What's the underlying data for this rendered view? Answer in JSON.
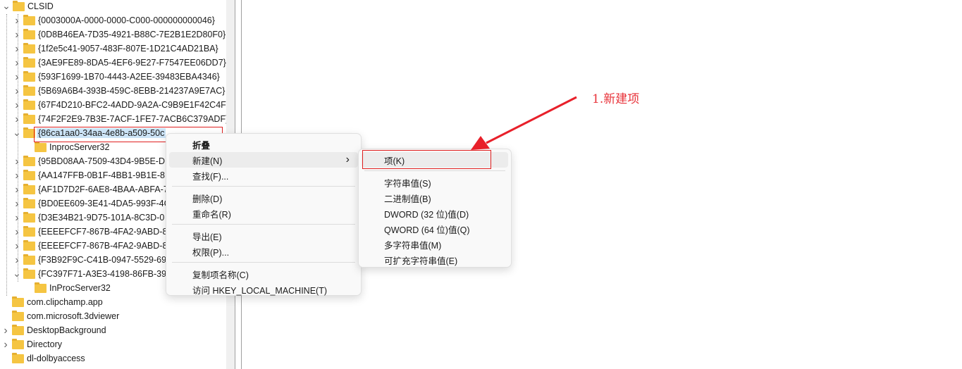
{
  "tree": {
    "root": {
      "label": "CLSID",
      "expanded": true
    },
    "children": [
      {
        "label": "{0003000A-0000-0000-C000-000000000046}"
      },
      {
        "label": "{0D8B46EA-7D35-4921-B88C-7E2B1E2D80F0}"
      },
      {
        "label": "{1f2e5c41-9057-483F-807E-1D21C4AD21BA}"
      },
      {
        "label": "{3AE9FE89-8DA5-4EF6-9E27-F7547EE06DD7}"
      },
      {
        "label": "{593F1699-1B70-4443-A2EE-39483EBA4346}"
      },
      {
        "label": "{5B69A6B4-393B-459C-8EBB-214237A9E7AC}"
      },
      {
        "label": "{67F4D210-BFC2-4ADD-9A2A-C9B9E1F42C4F}"
      },
      {
        "label": "{74F2F2E9-7B3E-7ACF-1FE7-7ACB6C379ADF}"
      },
      {
        "label": "{86ca1aa0-34aa-4e8b-a509-50c",
        "expanded": true,
        "selected": true
      },
      {
        "label": "InprocServer32",
        "child": true
      },
      {
        "label": "{95BD08AA-7509-43D4-9B5E-D"
      },
      {
        "label": "{AA147FFB-0B1F-4BB1-9B1E-8D"
      },
      {
        "label": "{AF1D7D2F-6AE8-4BAA-ABFA-7"
      },
      {
        "label": "{BD0EE609-3E41-4DA5-993F-4C"
      },
      {
        "label": "{D3E34B21-9D75-101A-8C3D-0"
      },
      {
        "label": "{EEEEFCF7-867B-4FA2-9ABD-88"
      },
      {
        "label": "{EEEEFCF7-867B-4FA2-9ABD-88"
      },
      {
        "label": "{F3B92F9C-C41B-0947-5529-69"
      },
      {
        "label": "{FC397F71-A3E3-4198-86FB-39E",
        "expanded": true
      },
      {
        "label": "InProcServer32",
        "child": true
      }
    ],
    "siblings": [
      {
        "label": "com.clipchamp.app",
        "chevron": false
      },
      {
        "label": "com.microsoft.3dviewer",
        "chevron": false
      },
      {
        "label": "DesktopBackground",
        "chevron": true
      },
      {
        "label": "Directory",
        "chevron": true
      },
      {
        "label": "dl-dolbyaccess",
        "chevron": false
      }
    ]
  },
  "context_menu": {
    "items": [
      {
        "label": "折叠",
        "bold": true
      },
      {
        "label": "新建(N)",
        "submenu": true,
        "highlighted": true
      },
      {
        "label": "查找(F)..."
      },
      {
        "sep": true
      },
      {
        "label": "删除(D)"
      },
      {
        "label": "重命名(R)"
      },
      {
        "sep": true
      },
      {
        "label": "导出(E)"
      },
      {
        "label": "权限(P)..."
      },
      {
        "sep": true
      },
      {
        "label": "复制项名称(C)"
      },
      {
        "label": "访问 HKEY_LOCAL_MACHINE(T)"
      }
    ]
  },
  "submenu": {
    "items": [
      {
        "label": "项(K)",
        "highlighted": true
      },
      {
        "sep": true
      },
      {
        "label": "字符串值(S)"
      },
      {
        "label": "二进制值(B)"
      },
      {
        "label": "DWORD (32 位)值(D)"
      },
      {
        "label": "QWORD (64 位)值(Q)"
      },
      {
        "label": "多字符串值(M)"
      },
      {
        "label": "可扩充字符串值(E)"
      }
    ]
  },
  "annotation": {
    "text": "1.新建项",
    "color": "#e8333a"
  }
}
